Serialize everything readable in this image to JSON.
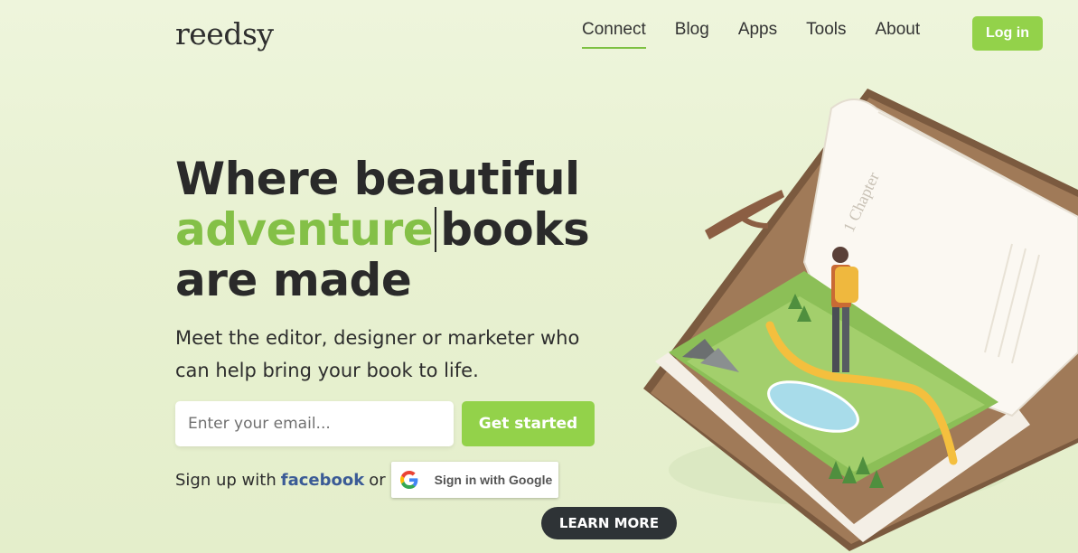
{
  "header": {
    "logo": "reedsy",
    "nav": [
      {
        "label": "Connect",
        "active": true
      },
      {
        "label": "Blog"
      },
      {
        "label": "Apps"
      },
      {
        "label": "Tools"
      },
      {
        "label": "About"
      }
    ],
    "login_label": "Log in"
  },
  "hero": {
    "headline_line1": "Where beautiful",
    "headline_accent": "adventure",
    "headline_rest": "books",
    "headline_line3": "are made",
    "subtitle": "Meet the editor, designer or marketer who can help bring your book to life.",
    "email_placeholder": "Enter your email...",
    "cta_label": "Get started",
    "signup_prefix": "Sign up with",
    "facebook_label": "facebook",
    "or_label": "or",
    "google_label": "Sign in with Google",
    "learn_more_label": "LEARN MORE",
    "illustration_text": "1 Chapter"
  },
  "colors": {
    "accent": "#84c047",
    "button": "#93d24a",
    "facebook": "#3b5b96",
    "dark_button": "#2e3336"
  }
}
